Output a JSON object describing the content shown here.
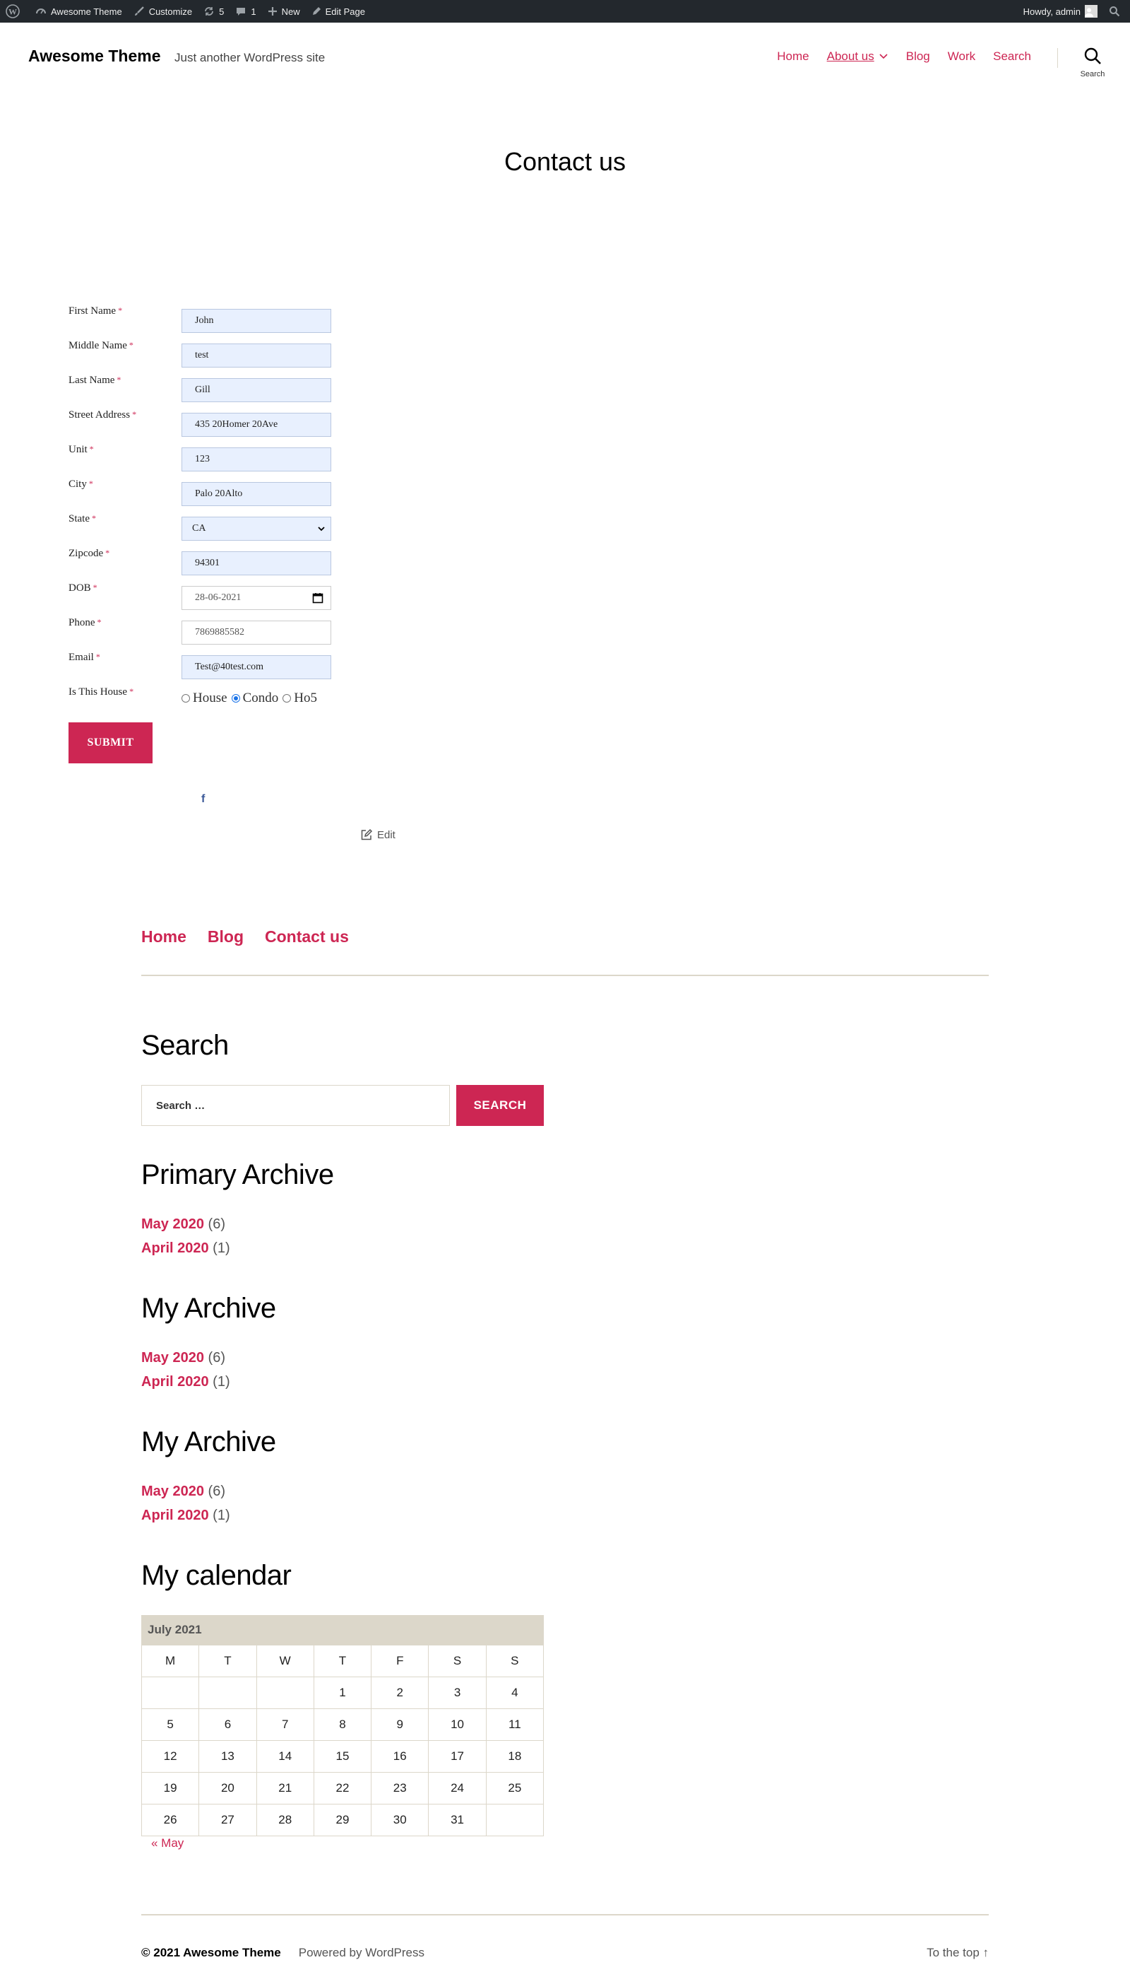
{
  "admin_bar": {
    "site_name": "Awesome Theme",
    "customize": "Customize",
    "updates_count": "5",
    "comments_count": "1",
    "new": "New",
    "edit_page": "Edit Page",
    "howdy": "Howdy, admin"
  },
  "header": {
    "site_title": "Awesome Theme",
    "tagline": "Just another WordPress site",
    "nav": [
      "Home",
      "About us",
      "Blog",
      "Work",
      "Search"
    ],
    "search_label": "Search"
  },
  "page": {
    "title": "Contact us"
  },
  "form": {
    "required_marker": "*",
    "fields": [
      {
        "label": "First Name",
        "value": "John"
      },
      {
        "label": "Middle Name",
        "value": "test"
      },
      {
        "label": "Last Name",
        "value": "Gill"
      },
      {
        "label": "Street Address",
        "value": "435 20Homer 20Ave"
      },
      {
        "label": "Unit",
        "value": "123"
      },
      {
        "label": "City",
        "value": "Palo 20Alto"
      },
      {
        "label": "State",
        "value": "CA"
      },
      {
        "label": "Zipcode",
        "value": "94301"
      },
      {
        "label": "DOB",
        "value": "28-06-2021"
      },
      {
        "label": "Phone",
        "value": "7869885582"
      },
      {
        "label": "Email",
        "value": "Test@40test.com"
      },
      {
        "label": "Is This House",
        "options": [
          "House",
          "Condo",
          "Ho5"
        ],
        "selected": "Condo"
      }
    ],
    "submit_label": "SUBMIT"
  },
  "social": {
    "icon": "facebook-icon",
    "glyph": "f"
  },
  "edit_link": "Edit",
  "footer_nav": [
    "Home",
    "Blog",
    "Contact us"
  ],
  "widgets": {
    "search": {
      "title": "Search",
      "placeholder": "Search …",
      "button": "SEARCH"
    },
    "archives": [
      {
        "title": "Primary Archive",
        "items": [
          {
            "month": "May 2020",
            "count": "(6)"
          },
          {
            "month": "April 2020",
            "count": "(1)"
          }
        ]
      },
      {
        "title": "My Archive",
        "items": [
          {
            "month": "May 2020",
            "count": "(6)"
          },
          {
            "month": "April 2020",
            "count": "(1)"
          }
        ]
      },
      {
        "title": "My Archive",
        "items": [
          {
            "month": "May 2020",
            "count": "(6)"
          },
          {
            "month": "April 2020",
            "count": "(1)"
          }
        ]
      }
    ],
    "calendar": {
      "title": "My calendar",
      "caption": "July 2021",
      "weekdays": [
        "M",
        "T",
        "W",
        "T",
        "F",
        "S",
        "S"
      ],
      "weeks": [
        [
          "",
          "",
          "",
          "1",
          "2",
          "3",
          "4"
        ],
        [
          "5",
          "6",
          "7",
          "8",
          "9",
          "10",
          "11"
        ],
        [
          "12",
          "13",
          "14",
          "15",
          "16",
          "17",
          "18"
        ],
        [
          "19",
          "20",
          "21",
          "22",
          "23",
          "24",
          "25"
        ],
        [
          "26",
          "27",
          "28",
          "29",
          "30",
          "31",
          ""
        ]
      ],
      "prev": "« May"
    }
  },
  "footer": {
    "copyright": "© 2021 Awesome Theme",
    "powered": "Powered by WordPress",
    "to_top": "To the top ↑"
  },
  "colors": {
    "accent": "#cd2653",
    "admin_bar": "#23282d",
    "border": "#dcd7ca"
  }
}
